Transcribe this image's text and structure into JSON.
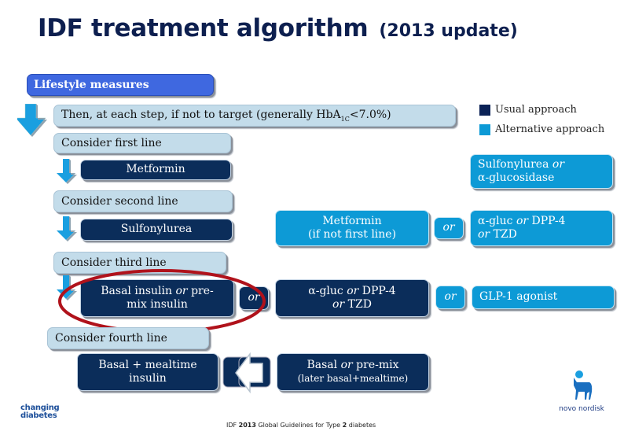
{
  "title": {
    "main": "IDF treatment algorithm",
    "sub": "(2013 update)"
  },
  "lifestyle": "Lifestyle measures",
  "target_step": {
    "prefix": "Then, at each step, if not to target (generally HbA",
    "subscript": "1C",
    "suffix": "<7.0%)"
  },
  "legend": [
    {
      "label": "Usual approach",
      "color": "#0b2256"
    },
    {
      "label": "Alternative approach",
      "color": "#0d9ad6"
    }
  ],
  "first_line": {
    "heading": "Consider first line",
    "usual": "Metformin",
    "alternative": {
      "a": "Sulfonylurea",
      "or": "or",
      "b": "α-glucosidase"
    }
  },
  "second_line": {
    "heading": "Consider second line",
    "usual": "Sulfonylurea",
    "alternative_1": {
      "line1": "Metformin",
      "line2": "(if not first line)"
    },
    "or_label": "or",
    "alternative_2": {
      "a": "α-gluc",
      "or1": "or",
      "b": "DPP-4",
      "or2": "or",
      "c": "TZD"
    }
  },
  "third_line": {
    "heading": "Consider third line",
    "usual_1": {
      "a": "Basal insulin",
      "or": "or",
      "b": "pre-",
      "c": "mix insulin"
    },
    "or_label_1": "or",
    "usual_2": {
      "a": "α-gluc",
      "or1": "or",
      "b": "DPP-4",
      "or2": "or",
      "c": "TZD"
    },
    "or_label_2": "or",
    "alternative": "GLP-1 agonist"
  },
  "fourth_line": {
    "heading": "Consider fourth line",
    "usual_1": {
      "line1": "Basal + mealtime",
      "line2": "insulin"
    },
    "usual_2": {
      "a": "Basal",
      "or": "or",
      "b": "pre-mix",
      "line2": "(later basal+mealtime)"
    }
  },
  "annotation": {
    "highlight": "red ellipse around Basal insulin or pre-mix insulin",
    "color": "#b0121b"
  },
  "footer": {
    "prefix": "IDF ",
    "year": "2013",
    "middle": " Global Guidelines for Type ",
    "type": "2",
    "suffix": " diabetes"
  },
  "logos": {
    "left": {
      "line1": "changing",
      "line2": "diabetes"
    },
    "right": "novo nordisk"
  }
}
